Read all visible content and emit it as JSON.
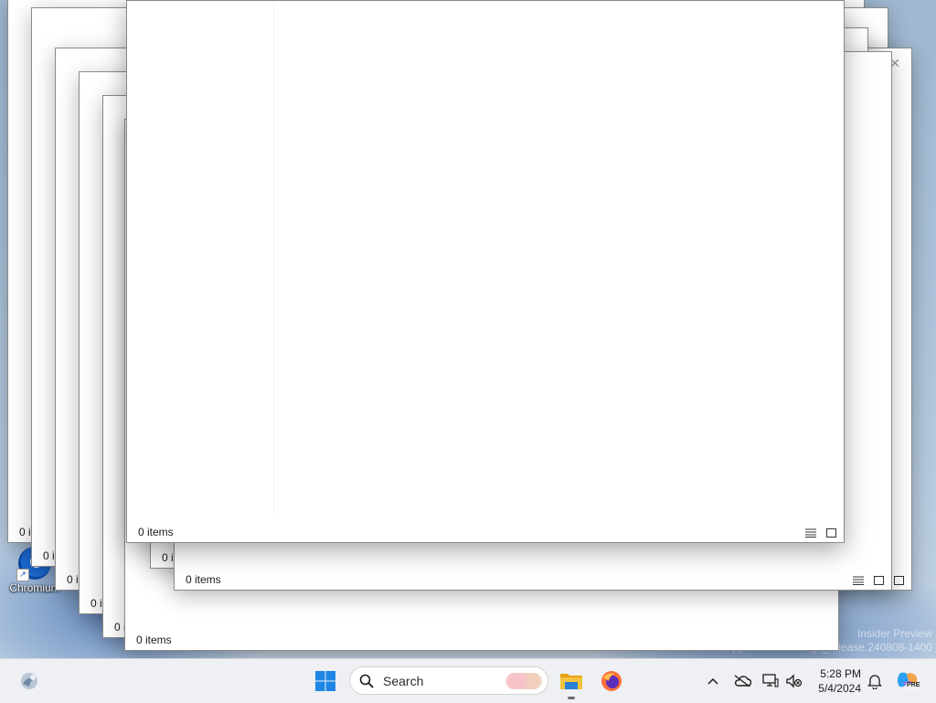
{
  "desktop": {
    "shortcut_label": "Chromium",
    "watermark_line1": "Insider Preview",
    "watermark_line2": "Evaluation copy. Build 26120.ge_release.240808-1400"
  },
  "windows": [
    {
      "id": "w1",
      "status_text": "0 items"
    },
    {
      "id": "w2",
      "status_text": "0 items"
    },
    {
      "id": "w3",
      "status_text": "0 items"
    },
    {
      "id": "w4",
      "status_text": "0 items"
    },
    {
      "id": "w5",
      "status_text": "0 items"
    },
    {
      "id": "w6",
      "status_text": "0 items"
    },
    {
      "id": "w7",
      "status_text": "0 items"
    },
    {
      "id": "w8",
      "status_text": "0 items"
    },
    {
      "id": "w9",
      "status_text": "0 items"
    },
    {
      "id": "w10",
      "status_text": "0 items"
    }
  ],
  "taskbar": {
    "search_placeholder": "Search",
    "time": "5:28 PM",
    "date": "5/4/2024",
    "pinned": [
      "widgets-icon",
      "start-icon",
      "search-icon",
      "file-explorer-icon",
      "firefox-icon"
    ],
    "tray": [
      "chevron-up-icon",
      "onedrive-offline-icon",
      "network-icon",
      "volume-muted-icon",
      "notification-bell-icon",
      "copilot-icon"
    ],
    "copilot_badge": "PRE"
  },
  "colors": {
    "accent": "#0067c0",
    "start_blue": "#1f86e5",
    "folder_yellow": "#f3b62c",
    "taskbar_bg": "#eef0f3"
  }
}
